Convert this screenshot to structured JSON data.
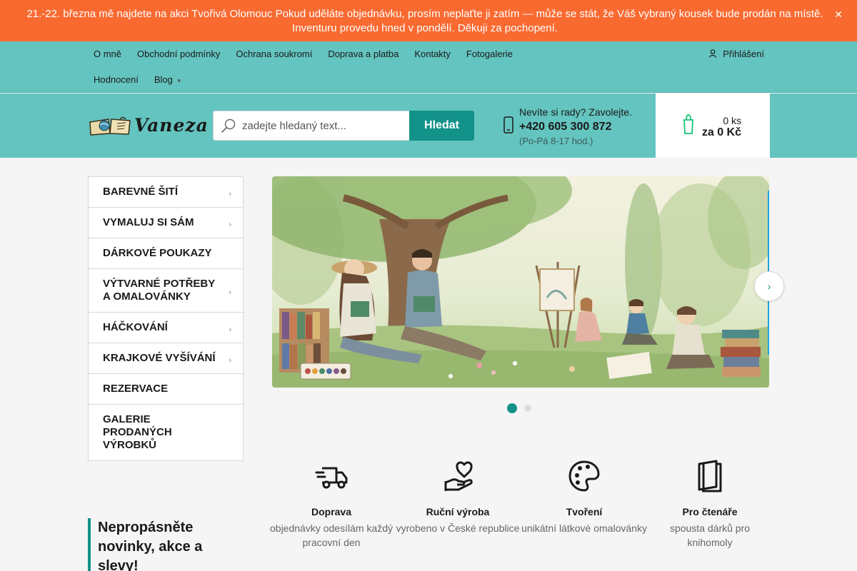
{
  "announcement": {
    "text": "21.-22. března mě najdete na akci Tvořivá Olomouc  Pokud uděláte objednávku, prosím neplaťte ji zatím — může se stát, že Váš vybraný kousek bude prodán na místě. Inventuru provedu hned v pondělí. Děkuji za pochopení.",
    "close_glyph": "✕"
  },
  "topnav": {
    "row1": [
      "O mně",
      "Obchodní podmínky",
      "Ochrana soukromí",
      "Doprava a platba",
      "Kontakty",
      "Fotogalerie"
    ],
    "row2": [
      "Hodnocení",
      "Blog"
    ],
    "blog_arrow": "▾",
    "login": "Přihlášení",
    "login_icon": "user-icon"
  },
  "header": {
    "logo_text": "Vaneza",
    "search": {
      "placeholder": "zadejte hledaný text...",
      "button": "Hledat"
    },
    "contact": {
      "question": "Nevíte si rady? Zavolejte.",
      "phone": "+420 605 300 872",
      "hours": "(Po-Pá 8-17 hod.)"
    },
    "cart": {
      "count": "0 ks",
      "total": "za 0 Kč"
    }
  },
  "sidebar": {
    "categories": [
      {
        "label": "BAREVNÉ ŠITÍ",
        "has_submenu": true
      },
      {
        "label": "VYMALUJ SI SÁM",
        "has_submenu": true
      },
      {
        "label": "DÁRKOVÉ POUKAZY",
        "has_submenu": false
      },
      {
        "label": "VÝTVARNÉ POTŘEBY A OMALOVÁNKY",
        "has_submenu": true
      },
      {
        "label": "HÁČKOVÁNÍ",
        "has_submenu": true
      },
      {
        "label": "KRAJKOVÉ VYŠÍVÁNÍ",
        "has_submenu": true
      },
      {
        "label": "REZERVACE",
        "has_submenu": false
      },
      {
        "label": "GALERIE PRODANÝCH VÝROBKŮ",
        "has_submenu": false
      }
    ],
    "arrow_glyph": "›"
  },
  "slider": {
    "next_glyph": "›",
    "slide_count": 2,
    "active_slide": 1
  },
  "features": [
    {
      "icon": "truck-icon",
      "title": "Doprava",
      "text": "objednávky odesílám každý pracovní den"
    },
    {
      "icon": "hand-heart-icon",
      "title": "Ruční výroba",
      "text": "vyrobeno v České republice"
    },
    {
      "icon": "palette-icon",
      "title": "Tvoření",
      "text": "unikátní látkové omalovánky"
    },
    {
      "icon": "book-icon",
      "title": "Pro čtenáře",
      "text": "spousta dárků pro knihomoly"
    }
  ],
  "newsletter": {
    "title": "Nepropásněte novinky, akce a slevy!"
  },
  "colors": {
    "accent": "#13928a",
    "header_bg": "#64c4bf",
    "announce_bg": "#f96a31"
  }
}
